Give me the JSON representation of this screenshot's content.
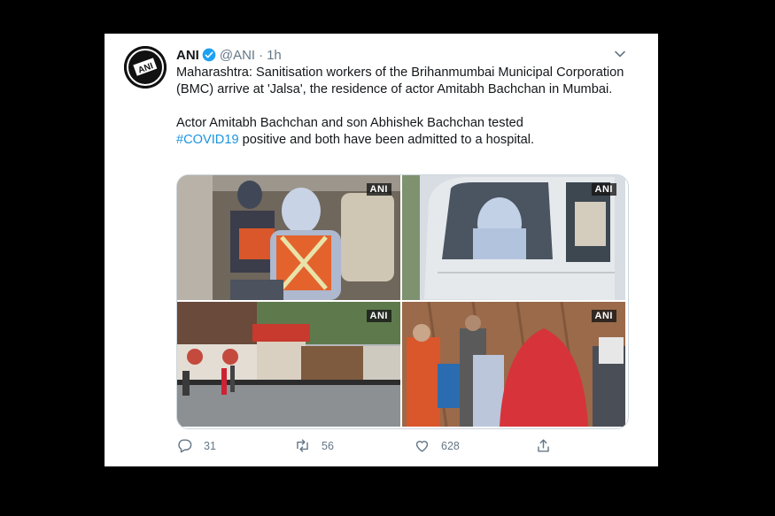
{
  "tweet": {
    "author_name": "ANI",
    "handle": "@ANI",
    "separator": "·",
    "time": "1h",
    "text_line1": "Maharashtra: Sanitisation workers of the Brihanmumbai Municipal Corporation (BMC) arrive at 'Jalsa', the residence of actor Amitabh Bachchan in Mumbai.",
    "text_line2_before": "Actor Amitabh Bachchan and son Abhishek Bachchan tested",
    "hashtag": "#COVID19",
    "text_line2_after": " positive and both have been admitted to a hospital."
  },
  "media": {
    "watermark": "ANI",
    "photos": [
      "car-interior-ppe-worker",
      "car-window-ppe-worker",
      "bungalow-gate-street",
      "workers-at-wooden-gate"
    ]
  },
  "actions": {
    "replies": "31",
    "retweets": "56",
    "likes": "628"
  },
  "icons": {
    "verified": "verified-badge-icon",
    "menu": "chevron-down-icon",
    "reply": "reply-icon",
    "retweet": "retweet-icon",
    "like": "heart-icon",
    "share": "share-icon"
  },
  "colors": {
    "link": "#1b95e0",
    "text": "#14171a",
    "muted": "#657786",
    "verified": "#1da1f2"
  }
}
